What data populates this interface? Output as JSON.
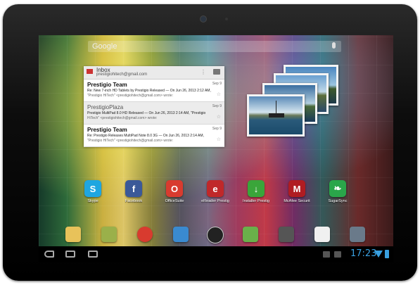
{
  "search": {
    "placeholder": "Google"
  },
  "gmail": {
    "label": "Inbox",
    "account": "prestigiohitech@gmail.com",
    "menu_glyph": "⋮",
    "messages": [
      {
        "from": "Prestigio Team",
        "date": "Sep 9",
        "subject": "Re: New 7-inch HD Tablets by Prestigio Released — On Jun 26, 2013 2:12 AM,",
        "snippet": "\"Prestigio HiTech\" <prestigiohitech@gmail.com> wrote:",
        "read": false
      },
      {
        "from": "PrestigioPlaza",
        "date": "Sep 9",
        "subject": "Prestigio MultiPad 8.0 HD Released — On Jun 26, 2013 2:14 AM, \"Prestigio",
        "snippet": "HiTech\" <prestigiohitech@gmail.com> wrote:",
        "read": true
      },
      {
        "from": "Prestigio Team",
        "date": "Sep 9",
        "subject": "Re: Prestigio Releases MultiPad Note 8.0 3G — On Jun 26, 2013 2:14 AM,",
        "snippet": "\"Prestigio HiTech\" <prestigiohitech@gmail.com> wrote:",
        "read": false
      }
    ]
  },
  "apps": [
    {
      "label": "Skype",
      "icon": "skype-icon",
      "color": "#1fa6e0",
      "glyph": "S"
    },
    {
      "label": "Facebook",
      "icon": "facebook-icon",
      "color": "#3b5998",
      "glyph": "f"
    },
    {
      "label": "OfficeSuite",
      "icon": "officesuite-icon",
      "color": "#d83b2f",
      "glyph": "O"
    },
    {
      "label": "eReader Prestig",
      "icon": "ereader-icon",
      "color": "#c0282a",
      "glyph": "e"
    },
    {
      "label": "Installer Prestig",
      "icon": "installer-icon",
      "color": "#3aa53a",
      "glyph": "↓"
    },
    {
      "label": "McAfee Securit",
      "icon": "mcafee-icon",
      "color": "#b01c22",
      "glyph": "M"
    },
    {
      "label": "SugarSync",
      "icon": "sugarsync-icon",
      "color": "#2aa64a",
      "glyph": "❧"
    }
  ],
  "dock": [
    {
      "icon": "email-icon",
      "color": "#e8c25a"
    },
    {
      "icon": "gallery-icon",
      "color": "#9ab04a"
    },
    {
      "icon": "chrome-icon",
      "color": "#d83b2f"
    },
    {
      "icon": "market-icon",
      "color": "#3a8ad0"
    },
    {
      "icon": "all-apps-icon",
      "color": "#222222"
    },
    {
      "icon": "maps-icon",
      "color": "#6ab04a"
    },
    {
      "icon": "video-icon",
      "color": "#555555"
    },
    {
      "icon": "play-store-icon",
      "color": "#f0f0f0"
    },
    {
      "icon": "camera-icon",
      "color": "#6a7a8a"
    }
  ],
  "status": {
    "time": "17:23"
  }
}
